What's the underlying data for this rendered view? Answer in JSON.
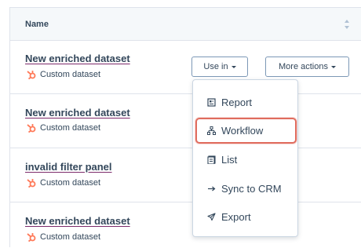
{
  "table": {
    "header": {
      "name_label": "Name"
    },
    "rows": [
      {
        "name": "New enriched dataset",
        "type": "Custom dataset"
      },
      {
        "name": "New enriched dataset",
        "type": "Custom dataset"
      },
      {
        "name": "invalid filter panel",
        "type": "Custom dataset"
      },
      {
        "name": "New enriched dataset",
        "type": "Custom dataset"
      }
    ]
  },
  "actions": {
    "use_in_label": "Use in",
    "more_actions_label": "More actions"
  },
  "menu": {
    "items": [
      {
        "label": "Report",
        "icon": "report-icon"
      },
      {
        "label": "Workflow",
        "icon": "workflow-icon",
        "selected": true
      },
      {
        "label": "List",
        "icon": "list-icon"
      },
      {
        "label": "Sync to CRM",
        "icon": "arrow-right-icon"
      },
      {
        "label": "Export",
        "icon": "export-icon"
      }
    ]
  },
  "colors": {
    "accent": "#ff7a59",
    "text": "#33475b",
    "highlight": "#e06c5e",
    "border": "#dfe3eb"
  }
}
